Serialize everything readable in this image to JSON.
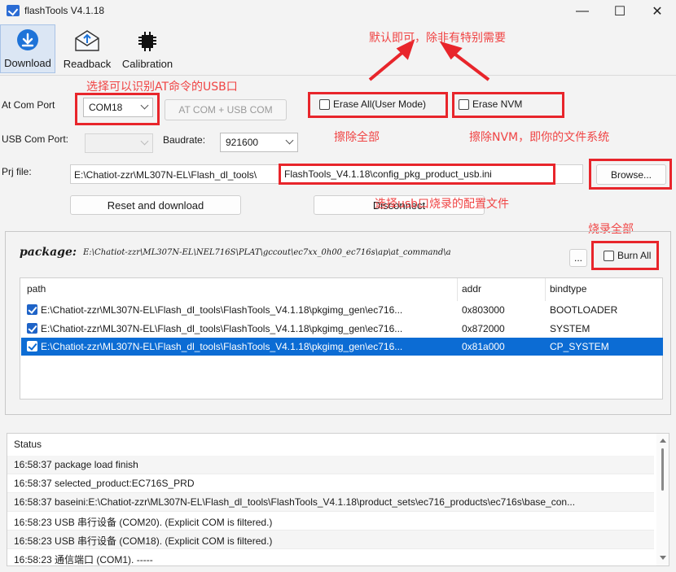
{
  "window": {
    "title": "flashTools V4.1.18",
    "minimize_glyph": "—",
    "maximize_glyph": "☐",
    "close_glyph": "✕"
  },
  "toolbar": {
    "items": [
      {
        "label": "Download",
        "icon": "download-icon",
        "active": true
      },
      {
        "label": "Readback",
        "icon": "readback-icon",
        "active": false
      },
      {
        "label": "Calibration",
        "icon": "chip-icon",
        "active": false
      }
    ]
  },
  "form": {
    "at_com_label": "At Com Port",
    "at_com_value": "COM18",
    "at_com_usb_button": "AT COM + USB COM",
    "usb_com_label": "USB Com Port:",
    "usb_com_value": "",
    "baud_label": "Baudrate:",
    "baud_value": "921600",
    "erase_all_label": "Erase All(User Mode)",
    "erase_nvm_label": "Erase NVM",
    "prj_label": "Prj file:",
    "prj_value_prefix": "E:\\Chatiot-zzr\\ML307N-EL\\Flash_dl_tools\\",
    "prj_value_highlight": "FlashTools_V4.1.18\\config_pkg_product_usb.ini",
    "browse_label": "Browse...",
    "reset_download_label": "Reset and download",
    "disconnect_label": "Disconnect"
  },
  "annotations": {
    "top": "默认即可，除非有特别需要",
    "select_port": "选择可以识别AT命令的USB口",
    "erase_all": "擦除全部",
    "erase_nvm": "擦除NVM，即你的文件系统",
    "config_file": "选择usb口烧录的配置文件",
    "burn_all": "烧录全部"
  },
  "package": {
    "label": "package:",
    "path": "E:\\Chatiot-zzr\\ML307N-EL\\NEL716S\\PLAT\\gccout\\ec7xx_0h00_ec716s\\ap\\at_command\\a",
    "more_label": "...",
    "burn_all_label": "Burn All",
    "columns": [
      "path",
      "addr",
      "bindtype"
    ],
    "rows": [
      {
        "path": "E:\\Chatiot-zzr\\ML307N-EL\\Flash_dl_tools\\FlashTools_V4.1.18\\pkgimg_gen\\ec716...",
        "addr": "0x803000",
        "bindtype": "BOOTLOADER",
        "checked": true,
        "selected": false
      },
      {
        "path": "E:\\Chatiot-zzr\\ML307N-EL\\Flash_dl_tools\\FlashTools_V4.1.18\\pkgimg_gen\\ec716...",
        "addr": "0x872000",
        "bindtype": "SYSTEM",
        "checked": true,
        "selected": false
      },
      {
        "path": "E:\\Chatiot-zzr\\ML307N-EL\\Flash_dl_tools\\FlashTools_V4.1.18\\pkgimg_gen\\ec716...",
        "addr": "0x81a000",
        "bindtype": "CP_SYSTEM",
        "checked": true,
        "selected": true
      }
    ]
  },
  "log": {
    "lines": [
      "Status",
      "16:58:37 package load finish",
      "16:58:37 selected_product:EC716S_PRD",
      "16:58:37 baseini:E:\\Chatiot-zzr\\ML307N-EL\\Flash_dl_tools\\FlashTools_V4.1.18\\product_sets\\ec716_products\\ec716s\\base_con...",
      "16:58:23 USB 串行设备 (COM20). (Explicit COM is filtered.)",
      "16:58:23 USB 串行设备 (COM18). (Explicit COM is filtered.)",
      "16:58:23 通信端口 (COM1). -----"
    ]
  },
  "colors": {
    "accent": "#0c6cd4",
    "annotation_red": "#e8252b"
  }
}
